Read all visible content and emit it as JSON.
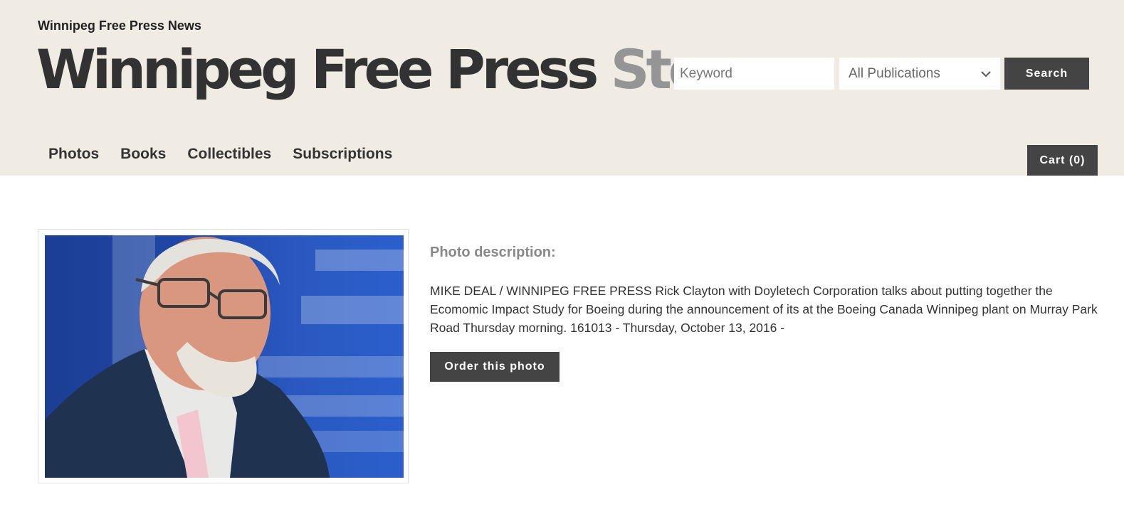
{
  "header": {
    "top_link": "Winnipeg Free Press News",
    "logo_main": "Winnipeg Free Press",
    "logo_accent": "Store",
    "search": {
      "placeholder": "Keyword",
      "publication_selected": "All Publications",
      "button_label": "Search"
    },
    "nav": [
      {
        "label": "Photos"
      },
      {
        "label": "Books"
      },
      {
        "label": "Collectibles"
      },
      {
        "label": "Subscriptions"
      }
    ],
    "cart_label": "Cart (0)"
  },
  "main": {
    "photo_icon": "photo-image",
    "description_heading": "Photo description:",
    "description": "MIKE DEAL / WINNIPEG FREE PRESS Rick Clayton with Doyletech Corporation talks about putting together the Ecomomic Impact Study for Boeing during the announcement of its at the Boeing Canada Winnipeg plant on Murray Park Road Thursday morning. 161013 - Thursday, October 13, 2016 -",
    "order_button": "Order this photo"
  },
  "colors": {
    "header_bg": "#f0ece4",
    "button_bg": "#444444",
    "logo_main": "#323232",
    "logo_accent": "#959595"
  }
}
